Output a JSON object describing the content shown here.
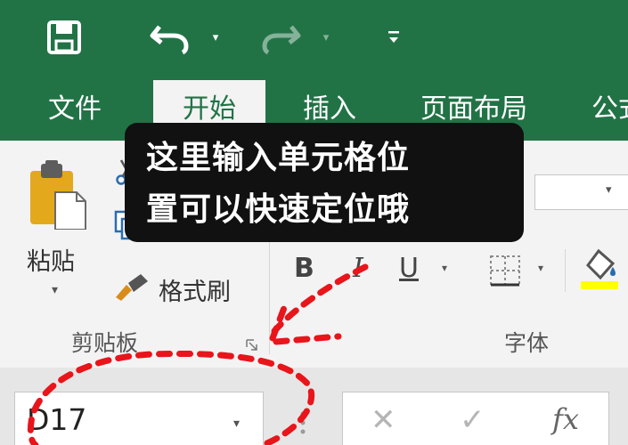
{
  "quick_access": {
    "save_icon": "save-icon",
    "undo_icon": "undo-icon",
    "redo_icon": "redo-icon",
    "dropdown_glyph": "▾",
    "customize_icon": "customize-quick-access-icon"
  },
  "tabs": [
    {
      "label": "文件"
    },
    {
      "label": "开始",
      "active": true
    },
    {
      "label": "插入"
    },
    {
      "label": "页面布局"
    },
    {
      "label": "公式"
    }
  ],
  "clipboard": {
    "paste_label": "粘贴",
    "format_painter_label": "格式刷",
    "group_label": "剪贴板"
  },
  "font": {
    "bold": "B",
    "italic": "I",
    "underline": "U",
    "group_label": "字体"
  },
  "formula_bar": {
    "name_box_value": "D17",
    "cancel_glyph": "✕",
    "enter_glyph": "✓",
    "fx_label": "fx"
  },
  "annotation": {
    "line1": "这里输入单元格位",
    "line2": "置可以快速定位哦",
    "mark_color": "#e8151b"
  },
  "colors": {
    "ribbon_green": "#217346",
    "ribbon_body": "#f3f3f3",
    "fill_yellow": "#ffff00"
  }
}
